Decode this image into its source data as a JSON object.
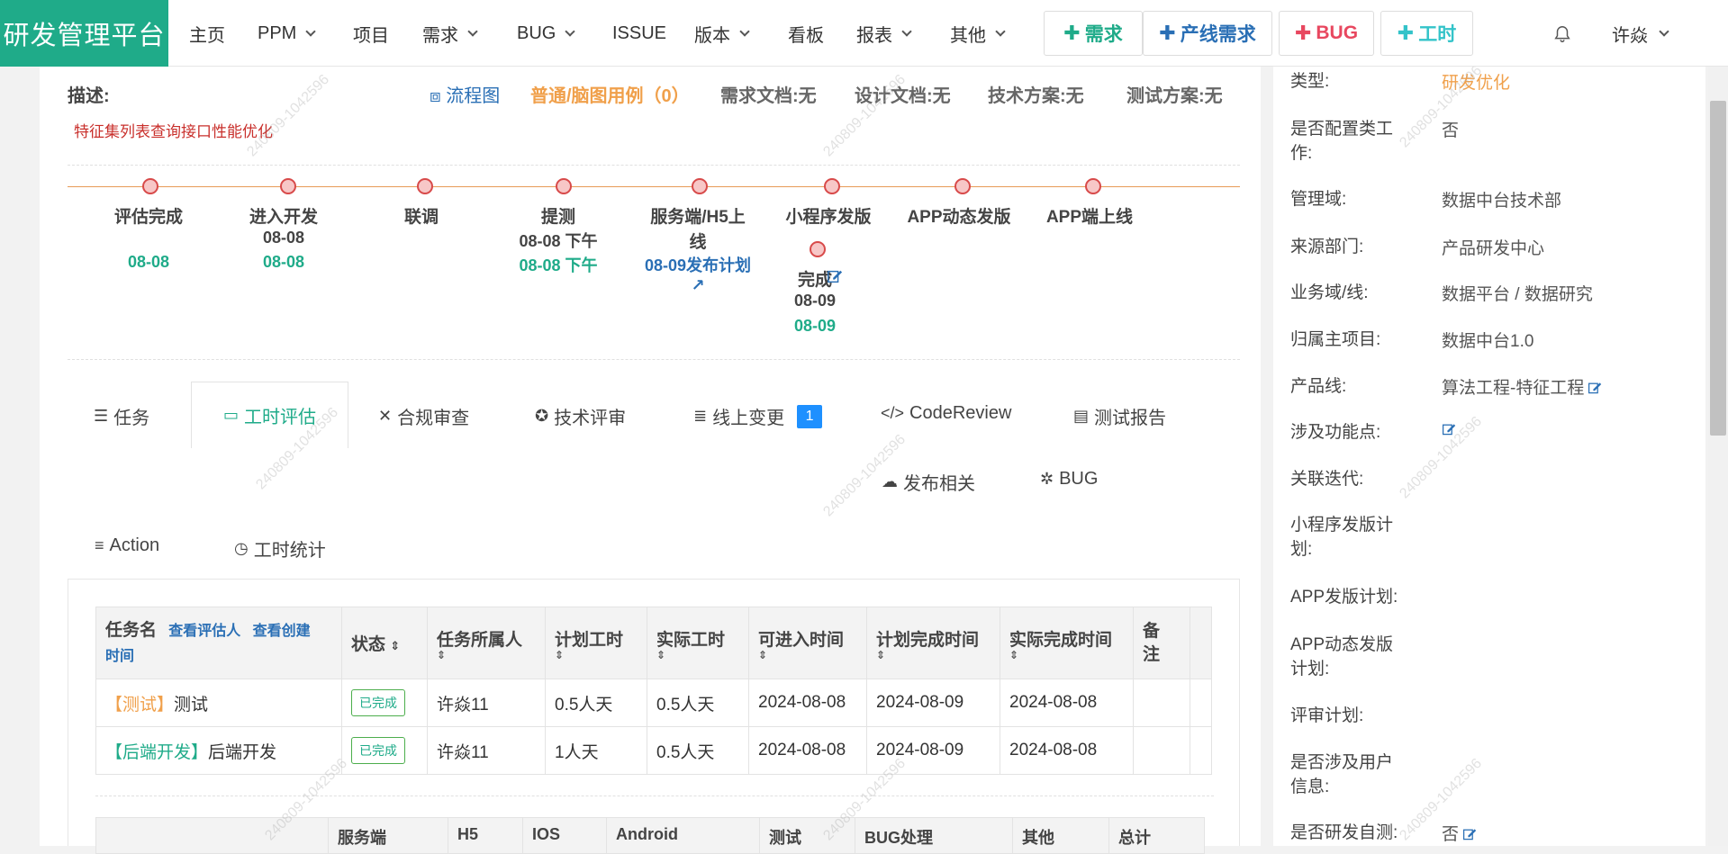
{
  "nav": {
    "brand": "研发管理平台",
    "items": [
      {
        "label": "主页",
        "dropdown": false
      },
      {
        "label": "PPM",
        "dropdown": true
      },
      {
        "label": "项目",
        "dropdown": false
      },
      {
        "label": "需求",
        "dropdown": true
      },
      {
        "label": "BUG",
        "dropdown": true
      },
      {
        "label": "ISSUE",
        "dropdown": false
      },
      {
        "label": "版本",
        "dropdown": true
      },
      {
        "label": "看板",
        "dropdown": false
      },
      {
        "label": "报表",
        "dropdown": true
      },
      {
        "label": "其他",
        "dropdown": true
      }
    ],
    "actions": [
      {
        "label": "需求",
        "color": "#1fab89"
      },
      {
        "label": "产线需求",
        "color": "#2a6fb5"
      },
      {
        "label": "BUG",
        "color": "#e8475f"
      },
      {
        "label": "工时",
        "color": "#33c3c9"
      }
    ],
    "user": "许焱"
  },
  "desc": {
    "label": "描述:",
    "text": "特征集列表查询接口性能优化",
    "flow_link": "流程图",
    "case_link": "普通/脑图用例（0）",
    "docs": [
      {
        "label": "需求文档:",
        "value": "无"
      },
      {
        "label": "设计文档:",
        "value": "无"
      },
      {
        "label": "技术方案:",
        "value": "无"
      },
      {
        "label": "测试方案:",
        "value": "无"
      }
    ]
  },
  "timeline": {
    "steps": [
      {
        "label": "评估完成",
        "planned": "",
        "actual": "08-08"
      },
      {
        "label": "进入开发",
        "planned": "08-08",
        "actual": "08-08"
      },
      {
        "label": "联调",
        "planned": "",
        "actual": ""
      },
      {
        "label": "提测",
        "planned": "08-08 下午",
        "actual": "08-08 下午"
      },
      {
        "label1": "服务端/H5上",
        "label2": "线",
        "plan_link": "08-09发布计划"
      },
      {
        "label": "小程序发版",
        "status": "完成",
        "planned": "08-09",
        "actual": "08-09"
      },
      {
        "label": "APP动态发版"
      },
      {
        "label": "APP端上线"
      }
    ]
  },
  "tabs": [
    {
      "label": "任务",
      "icon": "tasks-icon"
    },
    {
      "label": "工时评估",
      "icon": "monitor-icon",
      "active": true
    },
    {
      "label": "合规审查",
      "icon": "compliance-icon"
    },
    {
      "label": "技术评审",
      "icon": "review-icon"
    },
    {
      "label": "线上变更",
      "icon": "database-icon",
      "badge": "1"
    },
    {
      "label": "CodeReview",
      "icon": "code-icon"
    },
    {
      "label": "测试报告",
      "icon": "report-icon"
    },
    {
      "label": "发布相关",
      "icon": "cloud-upload-icon"
    },
    {
      "label": "BUG",
      "icon": "bug-icon"
    }
  ],
  "subtabs": [
    {
      "label": "Action",
      "icon": "list-icon"
    },
    {
      "label": "工时统计",
      "icon": "clock-icon"
    }
  ],
  "table": {
    "headers": {
      "name": "任务名",
      "view_assessor": "查看评估人",
      "view_created1": "查看创建",
      "view_created2": "时间",
      "status": "状态",
      "owner": "任务所属人",
      "plan": "计划工时",
      "actual": "实际工时",
      "enter": "可进入时间",
      "plan_done": "计划完成时间",
      "actual_done": "实际完成时间",
      "remark1": "备",
      "remark2": "注"
    },
    "rows": [
      {
        "tag": "【测试】",
        "name": "测试",
        "status": "已完成",
        "owner": "许焱11",
        "plan": "0.5人天",
        "actual": "0.5人天",
        "enter": "2024-08-08",
        "plan_done": "2024-08-09",
        "actual_done": "2024-08-08",
        "remark": ""
      },
      {
        "tag": "【后端开发】",
        "name": "后端开发",
        "status": "已完成",
        "owner": "许焱11",
        "plan": "1人天",
        "actual": "0.5人天",
        "enter": "2024-08-08",
        "plan_done": "2024-08-09",
        "actual_done": "2024-08-08",
        "remark": ""
      }
    ]
  },
  "table2": {
    "headers": [
      "",
      "服务端",
      "H5",
      "IOS",
      "Android",
      "测试",
      "BUG处理",
      "其他",
      "总计"
    ]
  },
  "info": [
    {
      "label": "类型:",
      "value": "研发优化",
      "value_color": "#f0a04b"
    },
    {
      "label": "是否配置类工作:",
      "value": "否"
    },
    {
      "label": "管理域:",
      "value": "数据中台技术部"
    },
    {
      "label": "来源部门:",
      "value": "产品研发中心"
    },
    {
      "label": "业务域/线:",
      "value": "数据平台 / 数据研究"
    },
    {
      "label": "归属主项目:",
      "value": "数据中台1.0"
    },
    {
      "label": "产品线:",
      "value": "算法工程-特征工程",
      "editable": true
    },
    {
      "label": "涉及功能点:",
      "value": "",
      "editable": true
    },
    {
      "label": "关联迭代:",
      "value": ""
    },
    {
      "label": "小程序发版计划:",
      "value": ""
    },
    {
      "label": "APP发版计划:",
      "value": ""
    },
    {
      "label": "APP动态发版计划:",
      "value": ""
    },
    {
      "label": "评审计划:",
      "value": ""
    },
    {
      "label": "是否涉及用户信息:",
      "value": ""
    },
    {
      "label": "是否研发自测:",
      "value": "否",
      "editable": true
    }
  ],
  "watermark": "240809-1042596"
}
